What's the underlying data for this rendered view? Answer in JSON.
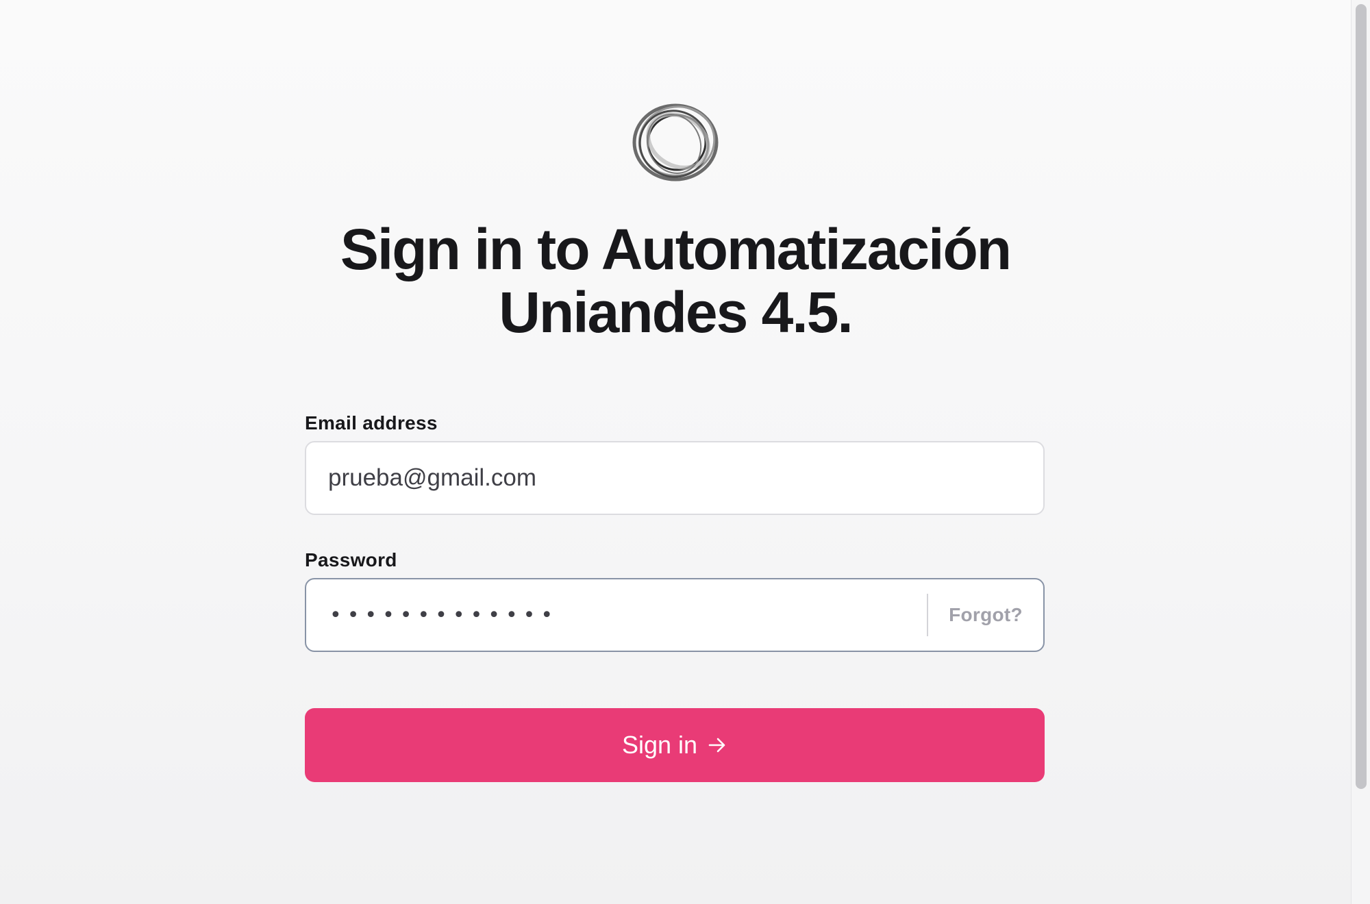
{
  "app": {
    "title_line1": "Sign in to Automatización",
    "title_line2": "Uniandes 4.5.",
    "logo_icon": "ring-logo-icon"
  },
  "form": {
    "email": {
      "label": "Email address",
      "value": "prueba@gmail.com"
    },
    "password": {
      "label": "Password",
      "masked_value": "•••••••••••••",
      "forgot_label": "Forgot?"
    },
    "submit": {
      "label": "Sign in",
      "icon": "arrow-right-icon"
    }
  },
  "colors": {
    "accent": "#e93b76",
    "text": "#18181b",
    "muted": "#a1a1aa",
    "field_border": "#dcdce0",
    "focused_border": "#8893a6"
  }
}
